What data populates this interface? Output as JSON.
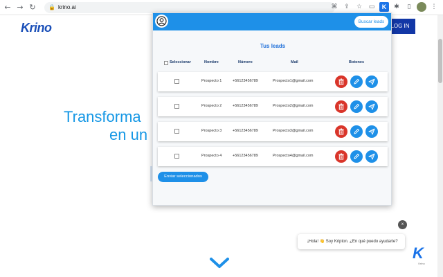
{
  "browser": {
    "url": "krino.ai",
    "back_glyph": "←",
    "forward_glyph": "→",
    "reload_glyph": "↻",
    "lock_glyph": "🔒",
    "ext_letter": "K"
  },
  "site": {
    "logo": "Krino",
    "login_label": "LOG IN",
    "hero_line1": "Transforma",
    "hero_line2": "en un"
  },
  "popup": {
    "search_button": "Buscar leads",
    "title": "Tus leads",
    "columns": {
      "select": "Seleccionar",
      "name": "Nombre",
      "number": "Número",
      "mail": "Mail",
      "buttons": "Botones"
    },
    "rows": [
      {
        "name": "Prospecto 1",
        "number": "+56123456789",
        "mail": "Prospecto1@gmail.com"
      },
      {
        "name": "Prospecto 2",
        "number": "+56123456789",
        "mail": "Prospecto2@gmail.com"
      },
      {
        "name": "Prospecto 3",
        "number": "+56123456789",
        "mail": "Prospecto3@gmail.com"
      },
      {
        "name": "Prospecto 4",
        "number": "+56123456789",
        "mail": "Prospecto4@gmail.com"
      }
    ],
    "send_selected": "Enviar seleccionados"
  },
  "chat": {
    "close_label": "x",
    "message": "¡Hola! 👋 Soy Kripton. ¿En qué puedo ayudarte?",
    "avatar_letter": "K",
    "avatar_caption": "Krino"
  },
  "colors": {
    "accent": "#1e90e8",
    "delete": "#d9352a",
    "hero": "#1597e5",
    "brand": "#1a4fb8"
  }
}
